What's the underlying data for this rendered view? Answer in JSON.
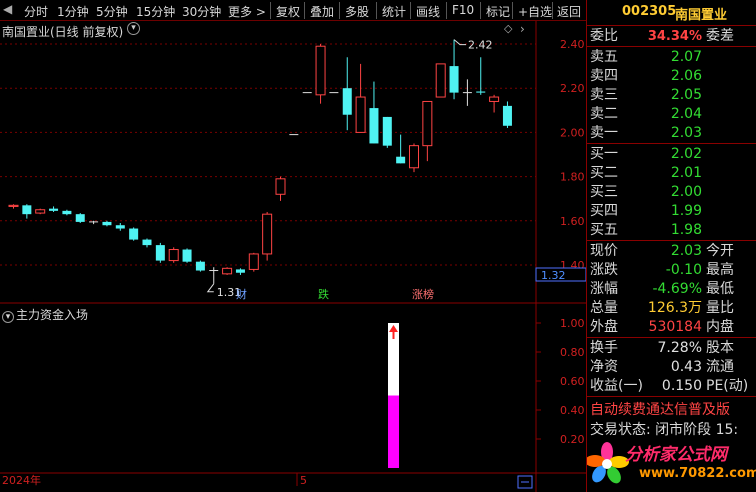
{
  "toolbar": {
    "items": [
      "分时",
      "1分钟",
      "5分钟",
      "15分钟",
      "30分钟",
      "更多 >",
      "复权",
      "叠加",
      "多股",
      "统计",
      "画线",
      "F10",
      "标记",
      "+自选",
      "返回"
    ]
  },
  "chart": {
    "title": "南国置业(日线 前复权)",
    "price_labels": [
      "2.40",
      "2.20",
      "2.00",
      "1.80",
      "1.60",
      "1.40"
    ],
    "current_price_tag": "1.32",
    "high_annotation": "2.42",
    "low_annotation": "1.31",
    "event_tags": [
      "财",
      "跌",
      "涨榜"
    ],
    "date_labels": [
      "2024年",
      "5"
    ]
  },
  "indicator": {
    "title": "主力资金入场",
    "labels": [
      "1.00",
      "0.80",
      "0.60",
      "0.40",
      "0.20"
    ],
    "bar_fill_fraction": 0.5
  },
  "quote": {
    "code": "002305",
    "name": "南国置业",
    "weibi_label": "委比",
    "weibi_value": "34.34%",
    "weicha_label": "委差",
    "sell": [
      {
        "label": "卖五",
        "price": "2.07"
      },
      {
        "label": "卖四",
        "price": "2.06"
      },
      {
        "label": "卖三",
        "price": "2.05"
      },
      {
        "label": "卖二",
        "price": "2.04"
      },
      {
        "label": "卖一",
        "price": "2.03"
      }
    ],
    "buy": [
      {
        "label": "买一",
        "price": "2.02"
      },
      {
        "label": "买二",
        "price": "2.01"
      },
      {
        "label": "买三",
        "price": "2.00"
      },
      {
        "label": "买四",
        "price": "1.99"
      },
      {
        "label": "买五",
        "price": "1.98"
      }
    ],
    "stats": [
      {
        "label": "现价",
        "value": "2.03",
        "suffix": "今开",
        "cls": "dn"
      },
      {
        "label": "涨跌",
        "value": "-0.10",
        "suffix": "最高",
        "cls": "dn"
      },
      {
        "label": "涨幅",
        "value": "-4.69%",
        "suffix": "最低",
        "cls": "dn"
      },
      {
        "label": "总量",
        "value": "126.3万",
        "suffix": "量比",
        "cls": "yl"
      },
      {
        "label": "外盘",
        "value": "530184",
        "suffix": "内盘",
        "cls": "up"
      }
    ],
    "stats2": [
      {
        "label": "换手",
        "value": "7.28%",
        "suffix": "股本",
        "cls": "wt"
      },
      {
        "label": "净资",
        "value": "0.43",
        "suffix": "流通",
        "cls": "wt"
      },
      {
        "label": "收益(一)",
        "value": "0.150",
        "suffix": "PE(动)",
        "cls": "wt"
      }
    ],
    "notice1": "自动续费通达信普及版",
    "notice2": "交易状态: 闭市阶段 15:",
    "watermark_main": "分析家公式网",
    "watermark_url": "www.70822.com"
  }
}
